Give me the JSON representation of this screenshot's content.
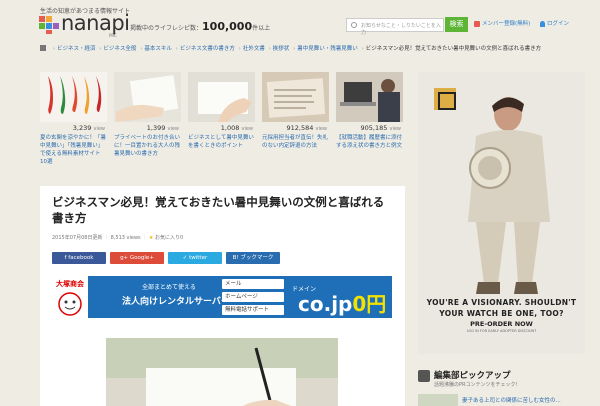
{
  "header": {
    "tagline": "生活の知恵があつまる情報サイト",
    "logo_text": "nanapi",
    "logo_sub": "PRC",
    "count_label": "掲載中のライフレシピ数：",
    "count_value": "100,000",
    "count_suffix": "件以上",
    "search_placeholder": "お知らせなこと・しりたいことを入力",
    "search_button": "検索",
    "signup_label": "メンバー登録(無料)",
    "login_label": "ログイン"
  },
  "breadcrumb": [
    "ビジネス・経済",
    "ビジネス全般",
    "基本スキル",
    "ビジネス文書の書き方",
    "社外文書",
    "挨拶状",
    "暑中見舞い・残暑見舞い"
  ],
  "breadcrumb_current": "ビジネスマン必見！覚えておきたい暑中見舞いの文例と喜ばれる書き方",
  "related": [
    {
      "views": "3,239",
      "unit": "view",
      "title": "夏の玄関を涼やかに！「暑中見舞い」「残暑見舞い」で使える無料素材サイト10選"
    },
    {
      "views": "1,399",
      "unit": "view",
      "title": "プライベートのお付き合いに！一目置かれる大人の残暑見舞いの書き方"
    },
    {
      "views": "1,008",
      "unit": "view",
      "title": "ビジネスとして暑中見舞いを書くときのポイント"
    },
    {
      "views": "912,584",
      "unit": "view",
      "title": "元採用担当者が直伝！失礼のない内定辞退の方法"
    },
    {
      "views": "905,185",
      "unit": "view",
      "title": "【就職活動】履歴書に添付する添え状の書き方と例文"
    }
  ],
  "article": {
    "title": "ビジネスマン必見！覚えておきたい暑中見舞いの文例と喜ばれる書き方",
    "date": "2015年07月08日更新",
    "views": "8,513 views",
    "favorite": "お気に入り0"
  },
  "share": [
    {
      "label": "facebook",
      "color": "#3b5998"
    },
    {
      "label": "Google+",
      "color": "#dd4b39"
    },
    {
      "label": "twitter",
      "color": "#2ba9e1"
    },
    {
      "label": "ブックマーク",
      "color": "#2a6cb0"
    }
  ],
  "banner_ad": {
    "brand": "大塚商会",
    "line1": "全部まとめて使える",
    "line2": "法人向けレンタルサーバー",
    "boxes": [
      "メール",
      "ホームページ",
      "無料電話サポート"
    ],
    "domain_label": "ドメイン",
    "domain": "co.jp",
    "price": "0円"
  },
  "side_ad": {
    "headline": "YOU'RE A VISIONARY. SHOULDN'T YOUR WATCH BE ONE, TOO?",
    "cta": "PRE-ORDER NOW",
    "fine": "LOG IN FOR EARLY ADOPTER DISCOUNT"
  },
  "pickup": {
    "title": "編集部ピックアップ",
    "subtitle": "話題沸騰のPRコンテンツをチェック！",
    "item": "妻子ある上司との関係に苦しむ女性の..."
  }
}
